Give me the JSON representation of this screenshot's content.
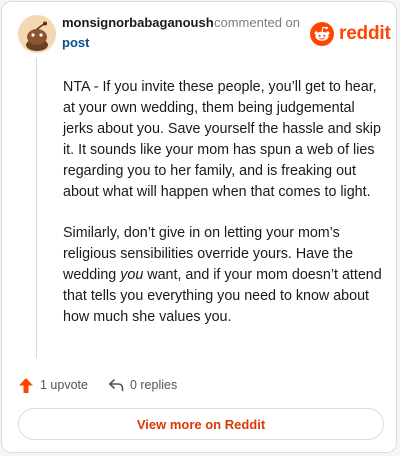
{
  "comment": {
    "author": "monsignorbabaganoush",
    "action_text": "commented on",
    "post_link_text": "post",
    "paragraphs": {
      "p1": "NTA - If you invite these people, you’ll get to hear, at your own wedding, them being judgemental jerks about you. Save yourself the hassle and skip it. It sounds like your mom has spun a web of lies regarding you to her family, and is freaking out about what will happen when that comes to light.",
      "p2_before": "Similarly, don’t give in on letting your mom’s religious sensibilities override yours. Have the wedding ",
      "p2_emphasis": "you",
      "p2_after": " want, and if your mom doesn’t attend that tells you everything you need to know about how much she values you."
    },
    "upvote_text": "1 upvote",
    "replies_text": "0 replies"
  },
  "brand": {
    "wordmark": "reddit",
    "icon": "reddit-snoo-icon",
    "color": "#ff4500"
  },
  "footer": {
    "view_more_label": "View more on Reddit"
  },
  "colors": {
    "accent": "#ff4500",
    "link": "#0b4f8c",
    "cta_text": "#d93a00"
  }
}
